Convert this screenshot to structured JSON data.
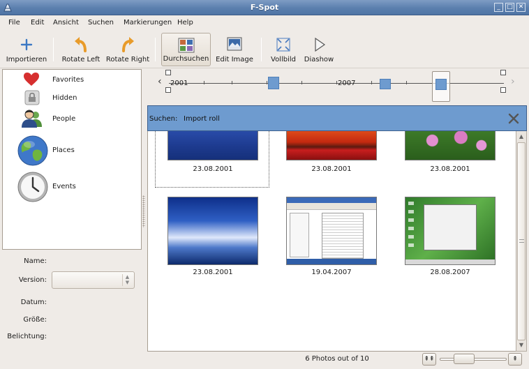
{
  "window": {
    "title": "F-Spot"
  },
  "menu": [
    {
      "label": "File"
    },
    {
      "label": "Edit"
    },
    {
      "label": "Ansicht"
    },
    {
      "label": "Suchen"
    },
    {
      "label": "Markierungen"
    },
    {
      "label": "Help"
    }
  ],
  "toolbar": {
    "import": "Importieren",
    "rotate_left": "Rotate Left",
    "rotate_right": "Rotate Right",
    "browse": "Durchsuchen",
    "edit_image": "Edit Image",
    "fullscreen": "Vollbild",
    "slideshow": "Diashow"
  },
  "categories": [
    {
      "label": "Favorites",
      "icon": "heart-icon"
    },
    {
      "label": "Hidden",
      "icon": "lock-icon"
    },
    {
      "label": "People",
      "icon": "people-icon"
    },
    {
      "label": "Places",
      "icon": "globe-icon"
    },
    {
      "label": "Events",
      "icon": "clock-icon"
    }
  ],
  "info": {
    "name": "Name:",
    "version": "Version:",
    "date": "Datum:",
    "size": "Größe:",
    "exposure": "Belichtung:"
  },
  "timeline": {
    "year_start": "2001",
    "year_mid": "2007"
  },
  "search": {
    "label": "Suchen:",
    "term": "Import roll"
  },
  "photos": [
    {
      "date": "23.08.2001"
    },
    {
      "date": "23.08.2001"
    },
    {
      "date": "23.08.2001"
    },
    {
      "date": "23.08.2001"
    },
    {
      "date": "19.04.2007"
    },
    {
      "date": "28.08.2007"
    }
  ],
  "status": {
    "count": "6 Photos out of 10"
  },
  "colors": {
    "accent": "#6e9bcf",
    "titlebar": "#5b7fae"
  }
}
